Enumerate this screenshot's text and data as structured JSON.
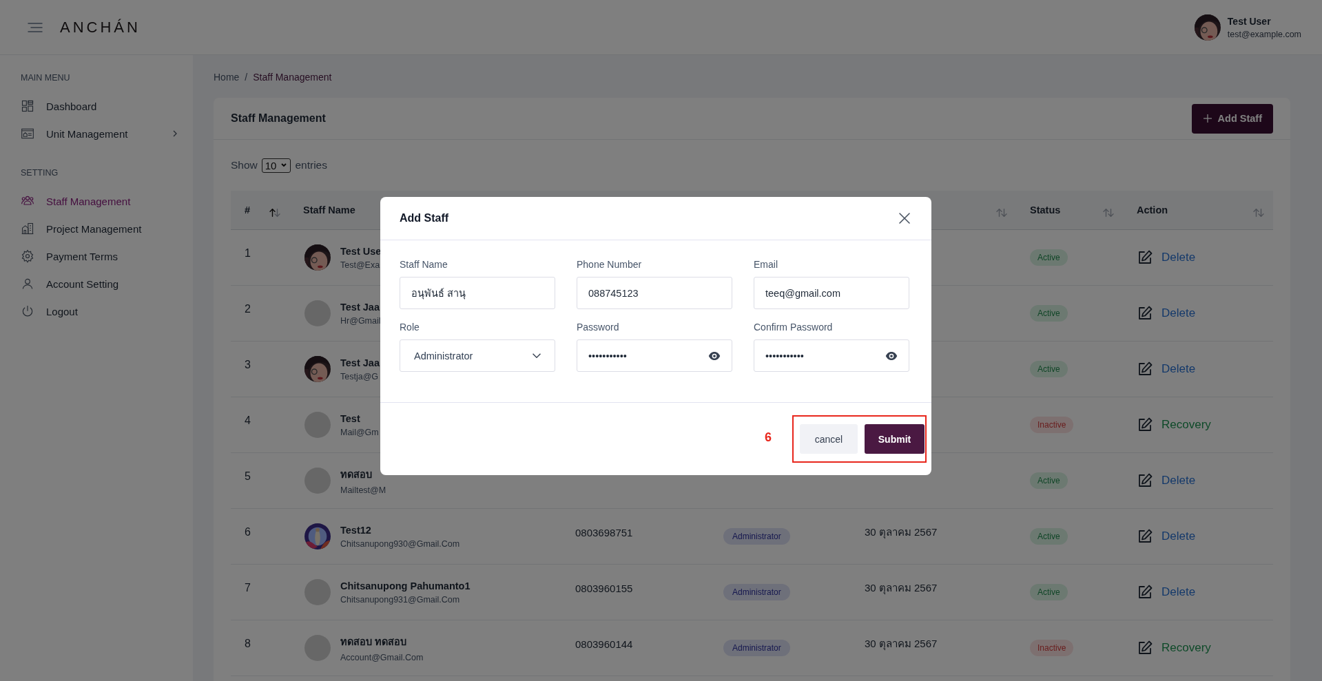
{
  "header": {
    "logo": "ANCHÁN",
    "user": {
      "name": "Test User",
      "email": "test@example.com"
    }
  },
  "sidebar": {
    "sections": [
      {
        "heading": "MAIN MENU",
        "items": [
          {
            "label": "Dashboard",
            "kind": "dashboard",
            "selected": false,
            "has_submenu": false
          },
          {
            "label": "Unit Management",
            "kind": "unit",
            "selected": false,
            "has_submenu": true
          }
        ]
      },
      {
        "heading": "SETTING",
        "items": [
          {
            "label": "Staff Management",
            "kind": "staff",
            "selected": true,
            "has_submenu": false
          },
          {
            "label": "Project Management",
            "kind": "project",
            "selected": false,
            "has_submenu": false
          },
          {
            "label": "Payment Terms",
            "kind": "payment",
            "selected": false,
            "has_submenu": false
          },
          {
            "label": "Account Setting",
            "kind": "account",
            "selected": false,
            "has_submenu": false
          },
          {
            "label": "Logout",
            "kind": "logout",
            "selected": false,
            "has_submenu": false
          }
        ]
      }
    ]
  },
  "breadcrumb": {
    "home": "Home",
    "separator": "/",
    "current": "Staff Management"
  },
  "card": {
    "title": "Staff Management",
    "add_button": "Add Staff",
    "show_label": "Show",
    "page_size": "10",
    "entries_label": "entries"
  },
  "table": {
    "columns": [
      {
        "kind": "index",
        "label": "#",
        "sorted": true
      },
      {
        "kind": "name",
        "label": "Staff Name"
      },
      {
        "kind": "phone"
      },
      {
        "kind": "role"
      },
      {
        "kind": "date",
        "sorted": false
      },
      {
        "kind": "status",
        "label": "Status",
        "sorted": false
      },
      {
        "kind": "action",
        "label": "Action",
        "sorted": false
      }
    ],
    "rows": [
      {
        "index": "1",
        "name": "Test Use",
        "email": "Test@Exa",
        "avatar": {
          "kind": "portrait"
        },
        "status": {
          "label": "Active",
          "kind": "active"
        },
        "action": {
          "label": "Delete",
          "kind": "delete"
        }
      },
      {
        "index": "2",
        "name": "Test Jaa",
        "email": "Hr@Gmail",
        "avatar": {
          "kind": "placeholder"
        },
        "status": {
          "label": "Active",
          "kind": "active"
        },
        "action": {
          "label": "Delete",
          "kind": "delete"
        }
      },
      {
        "index": "3",
        "name": "Test Jaa",
        "email": "Testja@G",
        "avatar": {
          "kind": "portrait"
        },
        "status": {
          "label": "Active",
          "kind": "active"
        },
        "action": {
          "label": "Delete",
          "kind": "delete"
        }
      },
      {
        "index": "4",
        "name": "Test",
        "email": "Mail@Gm",
        "avatar": {
          "kind": "placeholder"
        },
        "status": {
          "label": "Inactive",
          "kind": "inactive"
        },
        "action": {
          "label": "Recovery",
          "kind": "recovery"
        }
      },
      {
        "index": "5",
        "name": "ทดสอบ",
        "email": "Mailtest@M",
        "avatar": {
          "kind": "placeholder"
        },
        "status": {
          "label": "Active",
          "kind": "active"
        },
        "action": {
          "label": "Delete",
          "kind": "delete"
        }
      },
      {
        "index": "6",
        "name": "Test12",
        "email": "Chitsanupong930@Gmail.Com",
        "avatar": {
          "kind": "figure"
        },
        "phone": "0803698751",
        "role": "Administrator",
        "date": "30 ตุลาคม 2567",
        "status": {
          "label": "Active",
          "kind": "active"
        },
        "action": {
          "label": "Delete",
          "kind": "delete"
        }
      },
      {
        "index": "7",
        "name": "Chitsanupong Pahumanto1",
        "email": "Chitsanupong931@Gmail.Com",
        "avatar": {
          "kind": "placeholder"
        },
        "phone": "0803960155",
        "role": "Administrator",
        "date": "30 ตุลาคม 2567",
        "status": {
          "label": "Active",
          "kind": "active"
        },
        "action": {
          "label": "Delete",
          "kind": "delete"
        }
      },
      {
        "index": "8",
        "name": "ทดสอบ ทดสอบ",
        "email": "Account@Gmail.Com",
        "avatar": {
          "kind": "placeholder"
        },
        "phone": "0803960144",
        "role": "Administrator",
        "date": "30 ตุลาคม 2567",
        "status": {
          "label": "Inactive",
          "kind": "inactive"
        },
        "action": {
          "label": "Recovery",
          "kind": "recovery"
        }
      }
    ]
  },
  "modal": {
    "title": "Add Staff",
    "fields": [
      {
        "label": "Staff Name",
        "kind": "text",
        "value": "อนุพันธ์ สานุ"
      },
      {
        "label": "Phone Number",
        "kind": "text",
        "value": "088745123"
      },
      {
        "label": "Email",
        "kind": "text",
        "value": "teeq@gmail.com"
      },
      {
        "label": "Role",
        "kind": "select",
        "value": "Administrator"
      },
      {
        "label": "Password",
        "kind": "password",
        "value": "•••••••••••"
      },
      {
        "label": "Confirm Password",
        "kind": "password",
        "value": "•••••••••••"
      }
    ],
    "cancel": "cancel",
    "submit": "Submit",
    "annotation": "6"
  }
}
